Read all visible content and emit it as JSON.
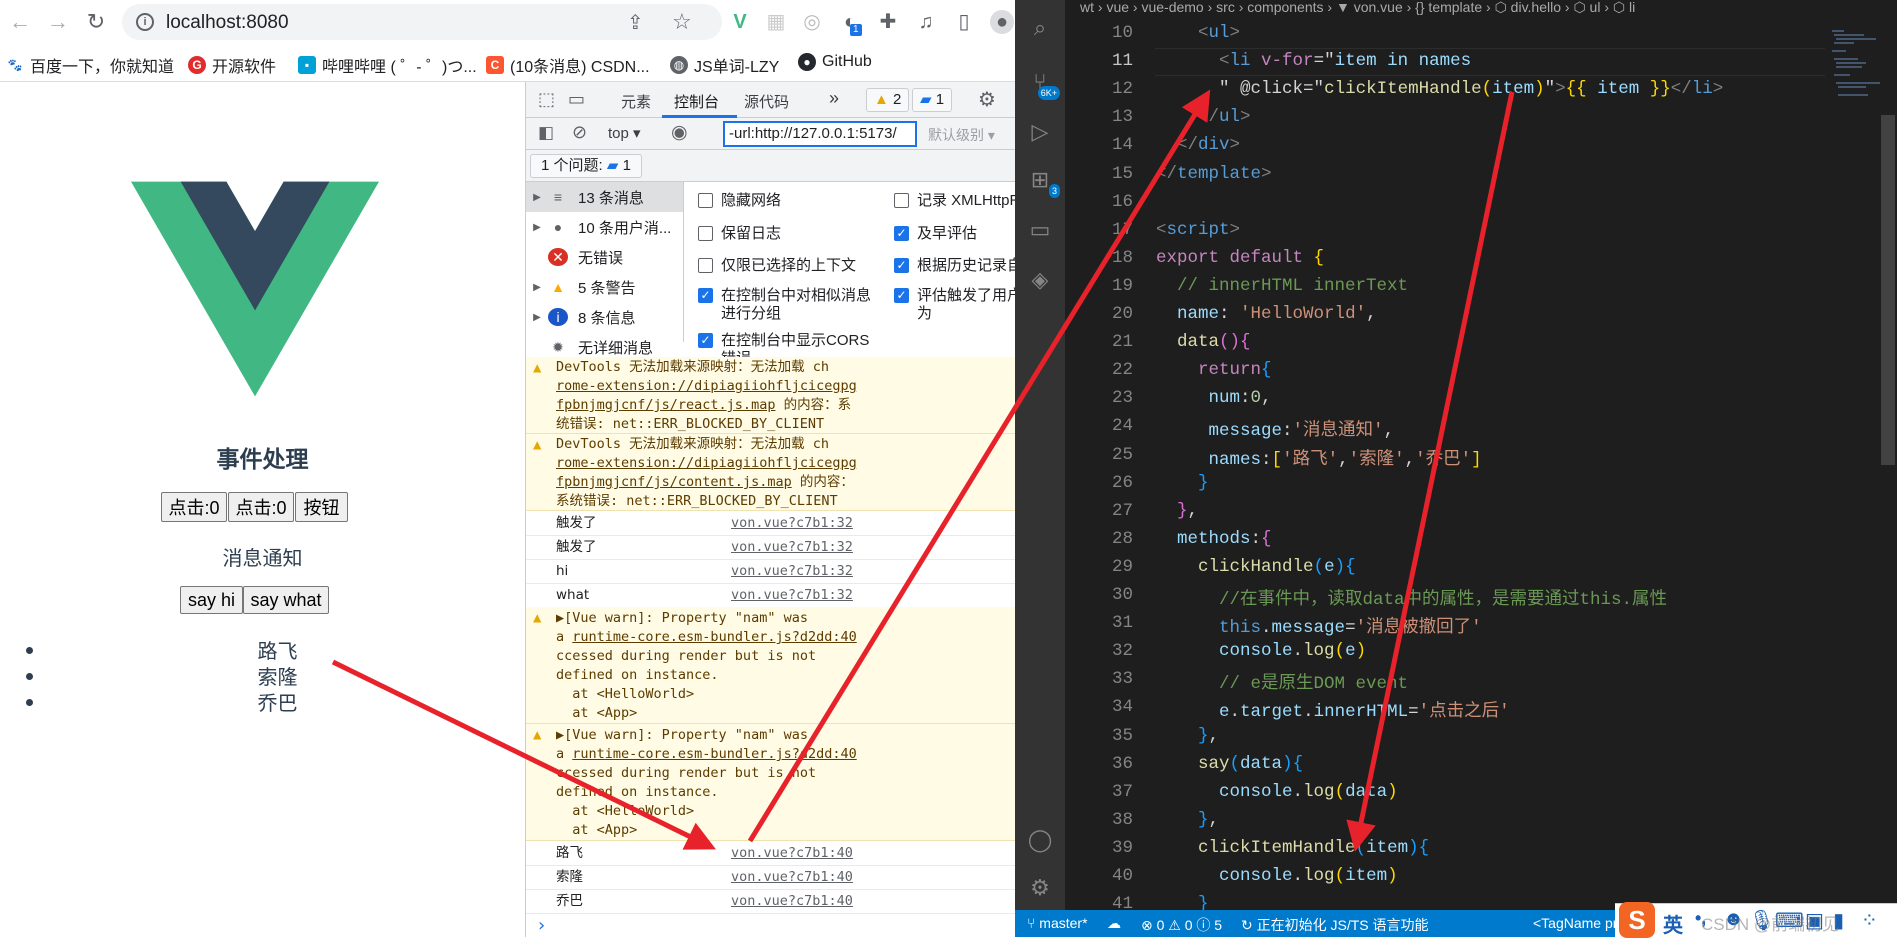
{
  "browser": {
    "url": "localhost:8080",
    "bookmarks": [
      {
        "label": "百度一下，你就知道",
        "icon": "baidu-icon",
        "color": "#2932e1"
      },
      {
        "label": "开源软件",
        "icon": "oschina-icon",
        "color": "#e02c2c"
      },
      {
        "label": "哔哩哔哩 ( ゜- ゜)つ...",
        "icon": "bilibili-icon",
        "color": "#00a1d6"
      },
      {
        "label": "(10条消息) CSDN...",
        "icon": "csdn-icon",
        "color": "#fc5531"
      },
      {
        "label": "JS单词-LZY",
        "icon": "globe-icon",
        "color": "#5f6368"
      },
      {
        "label": "GitHub",
        "icon": "github-icon",
        "color": "#24292f"
      }
    ],
    "extension_badge": "1"
  },
  "page": {
    "title": "事件处理",
    "buttons": [
      "点击:0",
      "点击:0",
      "按钮"
    ],
    "message": "消息通知",
    "say_buttons": [
      "say hi",
      "say what"
    ],
    "names": [
      "路飞",
      "索隆",
      "乔巴"
    ]
  },
  "devtools": {
    "tabs": [
      "元素",
      "控制台",
      "源代码"
    ],
    "active_tab": "控制台",
    "more": "»",
    "warn_count": "2",
    "info_count": "1",
    "context": "top",
    "filter_value": "-url:http://127.0.0.1:5173/",
    "level": "默认级别",
    "issues_label": "1 个问题:",
    "issues_count": "1",
    "sidebar": [
      {
        "label": "13 条消息",
        "icon": "list-icon"
      },
      {
        "label": "10 条用户消...",
        "icon": "user-icon"
      },
      {
        "label": "无错误",
        "icon": "error-icon"
      },
      {
        "label": "5 条警告",
        "icon": "warning-icon"
      },
      {
        "label": "8 条信息",
        "icon": "info-icon"
      },
      {
        "label": "无详细消息",
        "icon": "bug-icon"
      }
    ],
    "settings_left": [
      {
        "label": "隐藏网络",
        "checked": false
      },
      {
        "label": "保留日志",
        "checked": false
      },
      {
        "label": "仅限已选择的上下文",
        "checked": false
      },
      {
        "label": "在控制台中对相似消息\n进行分组",
        "checked": true
      },
      {
        "label": "在控制台中显示CORS\n错误",
        "checked": true
      }
    ],
    "settings_right": [
      {
        "label": "记录 XMLHttpRe",
        "checked": false
      },
      {
        "label": "及早评估",
        "checked": true
      },
      {
        "label": "根据历史记录自",
        "checked": true
      },
      {
        "label": "评估触发了用户\n为",
        "checked": true
      }
    ],
    "warnings_devtools": [
      {
        "l1": "DevTools 无法加载来源映射：无法加载 ch",
        "l2": "rome-extension://dipiagiiohfljcicegpg",
        "l3a": "fpbnjmgjcnf/js/react.js.map",
        "l3b": " 的内容：系",
        "l4": "统错误: net::ERR_BLOCKED_BY_CLIENT"
      },
      {
        "l1": "DevTools 无法加载来源映射：无法加载 ch",
        "l2": "rome-extension://dipiagiiohfljcicegpg",
        "l3a": "fpbnjmgjcnf/js/content.js.map",
        "l3b": " 的内容：",
        "l4": "系统错误: net::ERR_BLOCKED_BY_CLIENT"
      }
    ],
    "logs_a": [
      {
        "text": "触发了",
        "src": "von.vue?c7b1:32"
      },
      {
        "text": "触发了",
        "src": "von.vue?c7b1:32"
      },
      {
        "text": "hi",
        "src": "von.vue?c7b1:32"
      },
      {
        "text": "what",
        "src": "von.vue?c7b1:32"
      }
    ],
    "vue_warn": {
      "l1": "▶[Vue warn]: Property \"nam\" was",
      "l2a": "a ",
      "l2b": "runtime-core.esm-bundler.js?d2dd:40",
      "l3": "ccessed during render but is not",
      "l4": "defined on instance.",
      "l5": "  at <HelloWorld>",
      "l6": "  at <App>"
    },
    "logs_b": [
      {
        "text": "路飞",
        "src": "von.vue?c7b1:40"
      },
      {
        "text": "索隆",
        "src": "von.vue?c7b1:40"
      },
      {
        "text": "乔巴",
        "src": "von.vue?c7b1:40"
      }
    ],
    "prompt": "›"
  },
  "editor": {
    "breadcrumb": "wt › vue › vue-demo › src › components › ▼ von.vue › {} template › ⬡ div.hello › ⬡ ul › ⬡ li",
    "activity_badges": {
      "scm": "6K+",
      "extensions": "3"
    },
    "lines": [
      {
        "n": "10",
        "t": [
          [
            "    ",
            "t-p"
          ],
          [
            "<",
            "t-tag"
          ],
          [
            "ul",
            "t-el"
          ],
          [
            ">",
            "t-tag"
          ]
        ]
      },
      {
        "n": "11",
        "t": [
          [
            "      ",
            "t-p"
          ],
          [
            "<",
            "t-tag"
          ],
          [
            "li ",
            "t-el"
          ],
          [
            "v-for",
            "t-at"
          ],
          [
            "=\"",
            "t-p"
          ],
          [
            "item ",
            "t-var"
          ],
          [
            "in names",
            "t-var"
          ]
        ]
      },
      {
        "n": "12",
        "t": [
          [
            "      ",
            "t-p"
          ],
          [
            "\" ",
            "t-p"
          ],
          [
            "@click",
            "t-p"
          ],
          [
            "=\"",
            "t-p"
          ],
          [
            "clickItemHandle",
            "t-fn"
          ],
          [
            "(",
            "t-br1"
          ],
          [
            "item",
            "t-var"
          ],
          [
            ")",
            "t-br1"
          ],
          [
            "\"",
            "t-p"
          ],
          [
            ">",
            "t-tag"
          ],
          [
            "{{",
            "t-br1"
          ],
          [
            " item ",
            "t-var"
          ],
          [
            "}}",
            "t-br1"
          ],
          [
            "</",
            "t-tag"
          ],
          [
            "li",
            "t-el"
          ],
          [
            ">",
            "t-tag"
          ]
        ]
      },
      {
        "n": "13",
        "t": [
          [
            "    ",
            "t-p"
          ],
          [
            "</",
            "t-tag"
          ],
          [
            "ul",
            "t-el"
          ],
          [
            ">",
            "t-tag"
          ]
        ]
      },
      {
        "n": "14",
        "t": [
          [
            "  ",
            "t-p"
          ],
          [
            "</",
            "t-tag"
          ],
          [
            "div",
            "t-el"
          ],
          [
            ">",
            "t-tag"
          ]
        ]
      },
      {
        "n": "15",
        "t": [
          [
            "</",
            "t-tag"
          ],
          [
            "template",
            "t-el"
          ],
          [
            ">",
            "t-tag"
          ]
        ]
      },
      {
        "n": "16",
        "t": []
      },
      {
        "n": "17",
        "t": [
          [
            "<",
            "t-tag"
          ],
          [
            "script",
            "t-el"
          ],
          [
            ">",
            "t-tag"
          ]
        ]
      },
      {
        "n": "18",
        "t": [
          [
            "export ",
            "t-kw"
          ],
          [
            "default ",
            "t-kw"
          ],
          [
            "{",
            "t-br1"
          ]
        ]
      },
      {
        "n": "19",
        "t": [
          [
            "  ",
            "t-p"
          ],
          [
            "// innerHTML innerText",
            "t-cm"
          ]
        ]
      },
      {
        "n": "20",
        "t": [
          [
            "  ",
            "t-p"
          ],
          [
            "name",
            "t-var"
          ],
          [
            ": ",
            "t-p"
          ],
          [
            "'HelloWorld'",
            "t-str"
          ],
          [
            ",",
            "t-p"
          ]
        ]
      },
      {
        "n": "21",
        "t": [
          [
            "  ",
            "t-p"
          ],
          [
            "data",
            "t-fn"
          ],
          [
            "()",
            "t-br2"
          ],
          [
            "{",
            "t-br2"
          ]
        ]
      },
      {
        "n": "22",
        "t": [
          [
            "    ",
            "t-p"
          ],
          [
            "return",
            "t-kw"
          ],
          [
            "{",
            "t-br3"
          ]
        ]
      },
      {
        "n": "23",
        "t": [
          [
            "     ",
            "t-p"
          ],
          [
            "num",
            "t-var"
          ],
          [
            ":",
            "t-p"
          ],
          [
            "0",
            "t-num"
          ],
          [
            ",",
            "t-p"
          ]
        ]
      },
      {
        "n": "24",
        "t": [
          [
            "     ",
            "t-p"
          ],
          [
            "message",
            "t-var"
          ],
          [
            ":",
            "t-p"
          ],
          [
            "'消息通知'",
            "t-str"
          ],
          [
            ",",
            "t-p"
          ]
        ]
      },
      {
        "n": "25",
        "t": [
          [
            "     ",
            "t-p"
          ],
          [
            "names",
            "t-var"
          ],
          [
            ":",
            "t-p"
          ],
          [
            "[",
            "t-br1"
          ],
          [
            "'路飞'",
            "t-str"
          ],
          [
            ",",
            "t-p"
          ],
          [
            "'索隆'",
            "t-str"
          ],
          [
            ",",
            "t-p"
          ],
          [
            "'乔巴'",
            "t-str"
          ],
          [
            "]",
            "t-br1"
          ]
        ]
      },
      {
        "n": "26",
        "t": [
          [
            "    ",
            "t-p"
          ],
          [
            "}",
            "t-br3"
          ]
        ]
      },
      {
        "n": "27",
        "t": [
          [
            "  ",
            "t-p"
          ],
          [
            "}",
            "t-br2"
          ],
          [
            ",",
            "t-p"
          ]
        ]
      },
      {
        "n": "28",
        "t": [
          [
            "  ",
            "t-p"
          ],
          [
            "methods",
            "t-var"
          ],
          [
            ":",
            "t-p"
          ],
          [
            "{",
            "t-br2"
          ]
        ]
      },
      {
        "n": "29",
        "t": [
          [
            "    ",
            "t-p"
          ],
          [
            "clickHandle",
            "t-fn"
          ],
          [
            "(",
            "t-br3"
          ],
          [
            "e",
            "t-var"
          ],
          [
            ")",
            "t-br3"
          ],
          [
            "{",
            "t-br3"
          ]
        ]
      },
      {
        "n": "30",
        "t": [
          [
            "      ",
            "t-p"
          ],
          [
            "//在事件中，读取data中的属性，是需要通过this.属性",
            "t-cm"
          ]
        ]
      },
      {
        "n": "31",
        "t": [
          [
            "      ",
            "t-p"
          ],
          [
            "this",
            "t-el"
          ],
          [
            ".",
            "t-p"
          ],
          [
            "message",
            "t-var"
          ],
          [
            "=",
            "t-p"
          ],
          [
            "'消息被撤回了'",
            "t-str"
          ]
        ]
      },
      {
        "n": "32",
        "t": [
          [
            "      ",
            "t-p"
          ],
          [
            "console",
            "t-var"
          ],
          [
            ".",
            "t-p"
          ],
          [
            "log",
            "t-fn"
          ],
          [
            "(",
            "t-br1"
          ],
          [
            "e",
            "t-var"
          ],
          [
            ")",
            "t-br1"
          ]
        ]
      },
      {
        "n": "33",
        "t": [
          [
            "      ",
            "t-p"
          ],
          [
            "// e是原生DOM event",
            "t-cm"
          ]
        ]
      },
      {
        "n": "34",
        "t": [
          [
            "      ",
            "t-p"
          ],
          [
            "e",
            "t-var"
          ],
          [
            ".",
            "t-p"
          ],
          [
            "target",
            "t-var"
          ],
          [
            ".",
            "t-p"
          ],
          [
            "innerHTML",
            "t-var"
          ],
          [
            "=",
            "t-p"
          ],
          [
            "'点击之后'",
            "t-str"
          ]
        ]
      },
      {
        "n": "35",
        "t": [
          [
            "    ",
            "t-p"
          ],
          [
            "}",
            "t-br3"
          ],
          [
            ",",
            "t-p"
          ]
        ]
      },
      {
        "n": "36",
        "t": [
          [
            "    ",
            "t-p"
          ],
          [
            "say",
            "t-fn"
          ],
          [
            "(",
            "t-br3"
          ],
          [
            "data",
            "t-var"
          ],
          [
            ")",
            "t-br3"
          ],
          [
            "{",
            "t-br3"
          ]
        ]
      },
      {
        "n": "37",
        "t": [
          [
            "      ",
            "t-p"
          ],
          [
            "console",
            "t-var"
          ],
          [
            ".",
            "t-p"
          ],
          [
            "log",
            "t-fn"
          ],
          [
            "(",
            "t-br1"
          ],
          [
            "data",
            "t-var"
          ],
          [
            ")",
            "t-br1"
          ]
        ]
      },
      {
        "n": "38",
        "t": [
          [
            "    ",
            "t-p"
          ],
          [
            "}",
            "t-br3"
          ],
          [
            ",",
            "t-p"
          ]
        ]
      },
      {
        "n": "39",
        "t": [
          [
            "    ",
            "t-p"
          ],
          [
            "clickItemHandle",
            "t-fn"
          ],
          [
            "(",
            "t-br3"
          ],
          [
            "item",
            "t-var"
          ],
          [
            ")",
            "t-br3"
          ],
          [
            "{",
            "t-br3"
          ]
        ]
      },
      {
        "n": "40",
        "t": [
          [
            "      ",
            "t-p"
          ],
          [
            "console",
            "t-var"
          ],
          [
            ".",
            "t-p"
          ],
          [
            "log",
            "t-fn"
          ],
          [
            "(",
            "t-br1"
          ],
          [
            "item",
            "t-var"
          ],
          [
            ")",
            "t-br1"
          ]
        ]
      },
      {
        "n": "41",
        "t": [
          [
            "    ",
            "t-p"
          ],
          [
            "}",
            "t-br3"
          ]
        ]
      }
    ],
    "current_line": "11",
    "status": {
      "branch": "master*",
      "problems": "⊗ 0 ⚠ 0 ⓘ 5",
      "progress": "正在初始化 JS/TS 语言功能",
      "tag": "<TagName prop"
    },
    "status_color": "#007acc"
  },
  "ime": {
    "lang": "英",
    "punct": "•,",
    "watermark": "CSDN @前端初见"
  },
  "annotation_color": "#e8222a"
}
